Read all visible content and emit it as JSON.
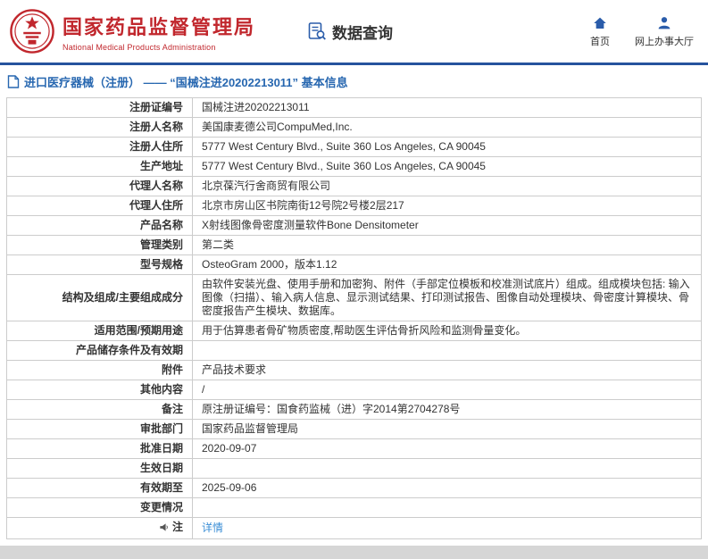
{
  "header": {
    "agency_name_cn": "国家药品监督管理局",
    "agency_name_en": "National Medical Products Administration",
    "data_query_label": "数据查询",
    "home_label": "首页",
    "service_hall_label": "网上办事大厅"
  },
  "page": {
    "title": "进口医疗器械（注册） —— “国械注进20202213011” 基本信息"
  },
  "icons": {
    "emblem": "national-emblem",
    "data_query": "doc-magnifier-icon",
    "home": "home-icon",
    "service_hall": "person-icon",
    "title": "document-icon",
    "note": "megaphone-icon"
  },
  "colors": {
    "brand_red": "#c1272d",
    "brand_blue": "#2a5caa",
    "title_blue": "#2767b0",
    "link_blue": "#3a8ed6",
    "header_border_blue": "#26539d"
  },
  "table": {
    "rows": [
      {
        "label": "注册证编号",
        "value": "国械注进20202213011"
      },
      {
        "label": "注册人名称",
        "value": "美国康麦德公司CompuMed,Inc."
      },
      {
        "label": "注册人住所",
        "value": "5777 West Century Blvd., Suite 360 Los Angeles, CA 90045"
      },
      {
        "label": "生产地址",
        "value": "5777 West Century Blvd., Suite 360 Los Angeles, CA 90045"
      },
      {
        "label": "代理人名称",
        "value": "北京葆汽行舍商贸有限公司"
      },
      {
        "label": "代理人住所",
        "value": "北京市房山区书院南街12号院2号楼2层217"
      },
      {
        "label": "产品名称",
        "value": "X射线图像骨密度测量软件Bone Densitometer"
      },
      {
        "label": "管理类别",
        "value": "第二类"
      },
      {
        "label": "型号规格",
        "value": "OsteoGram 2000，版本1.12"
      },
      {
        "label": "结构及组成/主要组成成分",
        "value": "由软件安装光盘、使用手册和加密狗、附件（手部定位模板和校准测试底片）组成。组成模块包括: 输入图像（扫描）、输入病人信息、显示测试结果、打印测试报告、图像自动处理模块、骨密度计算模块、骨密度报告产生模块、数据库。"
      },
      {
        "label": "适用范围/预期用途",
        "value": "用于估算患者骨矿物质密度,帮助医生评估骨折风险和监测骨量变化。"
      },
      {
        "label": "产品储存条件及有效期",
        "value": ""
      },
      {
        "label": "附件",
        "value": "产品技术要求"
      },
      {
        "label": "其他内容",
        "value": "/"
      },
      {
        "label": "备注",
        "value": "原注册证编号：国食药监械（进）字2014第2704278号"
      },
      {
        "label": "审批部门",
        "value": "国家药品监督管理局"
      },
      {
        "label": "批准日期",
        "value": "2020-09-07"
      },
      {
        "label": "生效日期",
        "value": ""
      },
      {
        "label": "有效期至",
        "value": "2025-09-06"
      },
      {
        "label": "变更情况",
        "value": ""
      },
      {
        "label": "注",
        "value": "详情",
        "link": true,
        "icon": "megaphone-icon"
      }
    ]
  }
}
